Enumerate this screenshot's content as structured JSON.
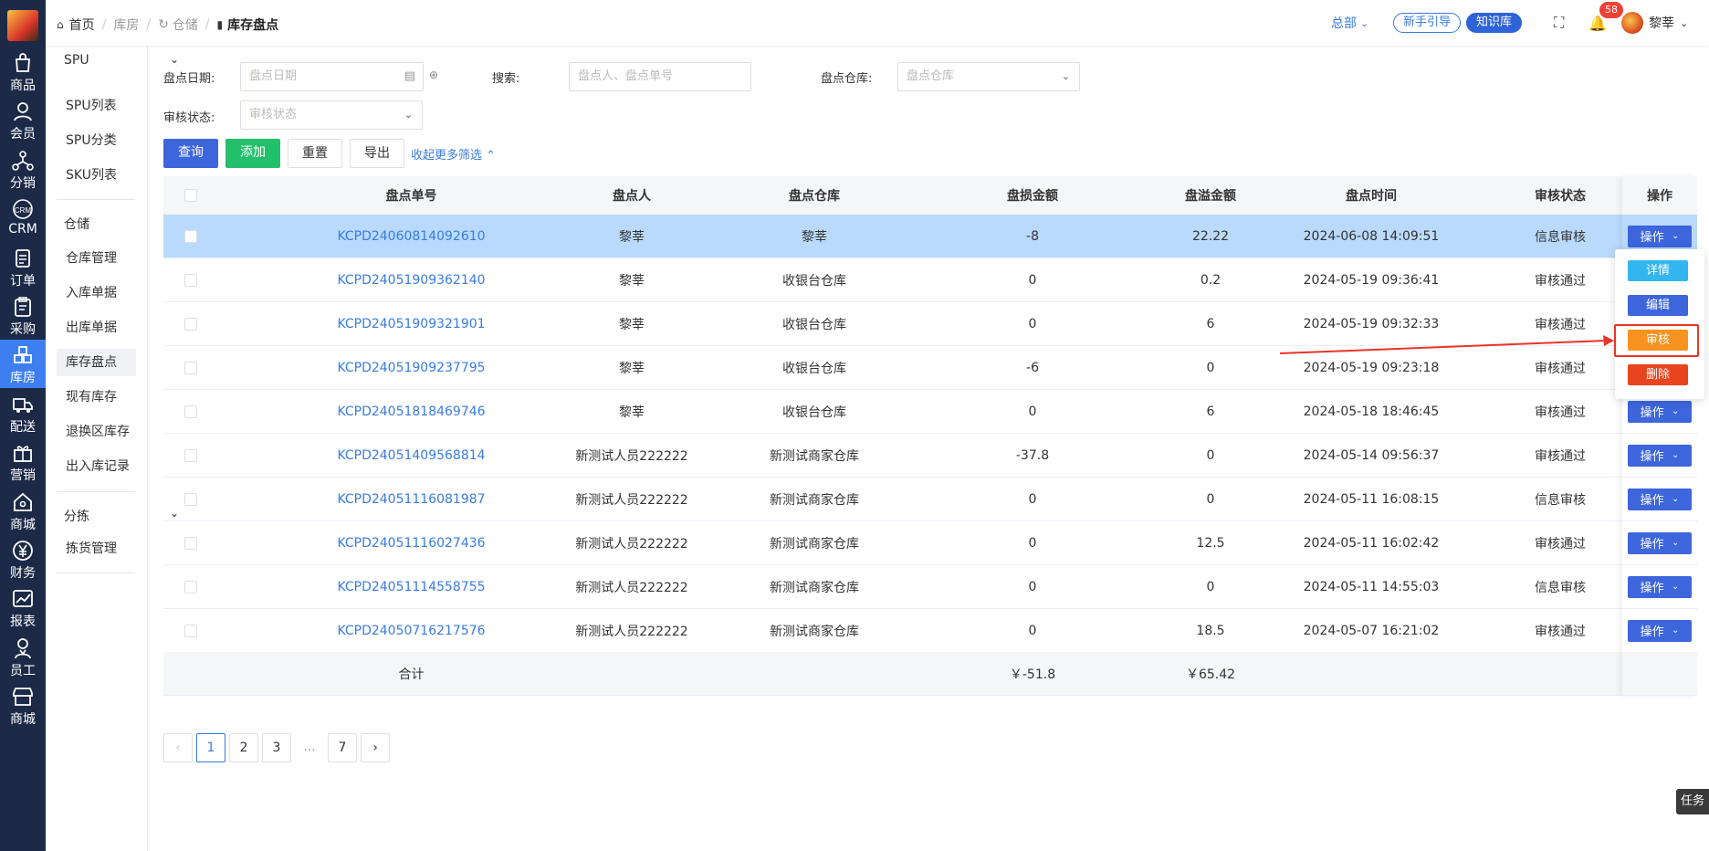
{
  "colors": {
    "primary": "#3d65dc",
    "accent": "#3d7ff0",
    "success": "#23c06b",
    "review": "#f7931e",
    "danger": "#e8451e",
    "info": "#33b6ef",
    "link": "#3a7be0",
    "selected_row": "#b9dafd",
    "sidebar_bg": "#1c2a48"
  },
  "topbar": {
    "breadcrumb": [
      "首页",
      "库房",
      "仓储",
      "库存盘点"
    ],
    "org": "总部",
    "guide": "新手引导",
    "knowledge": "知识库",
    "notifications": "58",
    "user": "黎莘"
  },
  "leftnav": [
    {
      "label": "商品",
      "icon": "bag-icon"
    },
    {
      "label": "会员",
      "icon": "user-icon"
    },
    {
      "label": "分销",
      "icon": "network-icon"
    },
    {
      "label": "CRM",
      "icon": "crm-icon"
    },
    {
      "label": "订单",
      "icon": "order-icon"
    },
    {
      "label": "采购",
      "icon": "clipboard-icon"
    },
    {
      "label": "库房",
      "icon": "warehouse-icon",
      "active": true
    },
    {
      "label": "配送",
      "icon": "truck-icon"
    },
    {
      "label": "营销",
      "icon": "gift-icon"
    },
    {
      "label": "商城",
      "icon": "home-icon"
    },
    {
      "label": "财务",
      "icon": "yen-icon"
    },
    {
      "label": "报表",
      "icon": "chart-icon"
    },
    {
      "label": "员工",
      "icon": "staff-icon"
    },
    {
      "label": "商城",
      "icon": "store-icon"
    }
  ],
  "subnav": {
    "groups": [
      {
        "title": "SPU",
        "items": [
          "SPU列表",
          "SPU分类",
          "SKU列表"
        ]
      },
      {
        "title": "仓储",
        "items": [
          "仓库管理",
          "入库单据",
          "出库单据",
          "库存盘点",
          "现有库存",
          "退换区库存",
          "出入库记录"
        ]
      },
      {
        "title": "分拣",
        "items": [
          "拣货管理"
        ]
      }
    ],
    "collapse": "收起"
  },
  "filters": {
    "date_label": "盘点日期:",
    "date_placeholder": "盘点日期",
    "search_label": "搜索:",
    "search_placeholder": "盘点人、盘点单号",
    "warehouse_label": "盘点仓库:",
    "warehouse_placeholder": "盘点仓库",
    "status_label": "审核状态:",
    "status_placeholder": "审核状态"
  },
  "buttons": {
    "query": "查询",
    "add": "添加",
    "reset": "重置",
    "export": "导出",
    "toggle": "收起更多筛选"
  },
  "table": {
    "columns": [
      "盘点单号",
      "盘点人",
      "盘点仓库",
      "盘损金额",
      "盘溢金额",
      "盘点时间",
      "审核状态",
      "操作"
    ],
    "op_label": "操作",
    "rows": [
      {
        "id": "KCPD24060814092610",
        "person": "黎莘",
        "warehouse": "黎莘",
        "loss": "-8",
        "gain": "22.22",
        "time": "2024-06-08 14:09:51",
        "status": "信息审核",
        "selected": true
      },
      {
        "id": "KCPD24051909362140",
        "person": "黎莘",
        "warehouse": "收银台仓库",
        "loss": "0",
        "gain": "0.2",
        "time": "2024-05-19 09:36:41",
        "status": "审核通过"
      },
      {
        "id": "KCPD24051909321901",
        "person": "黎莘",
        "warehouse": "收银台仓库",
        "loss": "0",
        "gain": "6",
        "time": "2024-05-19 09:32:33",
        "status": "审核通过"
      },
      {
        "id": "KCPD24051909237795",
        "person": "黎莘",
        "warehouse": "收银台仓库",
        "loss": "-6",
        "gain": "0",
        "time": "2024-05-19 09:23:18",
        "status": "审核通过"
      },
      {
        "id": "KCPD24051818469746",
        "person": "黎莘",
        "warehouse": "收银台仓库",
        "loss": "0",
        "gain": "6",
        "time": "2024-05-18 18:46:45",
        "status": "审核通过"
      },
      {
        "id": "KCPD24051409568814",
        "person": "新测试人员222222",
        "warehouse": "新测试商家仓库",
        "loss": "-37.8",
        "gain": "0",
        "time": "2024-05-14 09:56:37",
        "status": "审核通过"
      },
      {
        "id": "KCPD24051116081987",
        "person": "新测试人员222222",
        "warehouse": "新测试商家仓库",
        "loss": "0",
        "gain": "0",
        "time": "2024-05-11 16:08:15",
        "status": "信息审核"
      },
      {
        "id": "KCPD24051116027436",
        "person": "新测试人员222222",
        "warehouse": "新测试商家仓库",
        "loss": "0",
        "gain": "12.5",
        "time": "2024-05-11 16:02:42",
        "status": "审核通过"
      },
      {
        "id": "KCPD24051114558755",
        "person": "新测试人员222222",
        "warehouse": "新测试商家仓库",
        "loss": "0",
        "gain": "0",
        "time": "2024-05-11 14:55:03",
        "status": "信息审核"
      },
      {
        "id": "KCPD24050716217576",
        "person": "新测试人员222222",
        "warehouse": "新测试商家仓库",
        "loss": "0",
        "gain": "18.5",
        "time": "2024-05-07 16:21:02",
        "status": "审核通过"
      }
    ],
    "total": {
      "label": "合计",
      "loss": "￥-51.8",
      "gain": "￥65.42"
    }
  },
  "pagination": {
    "pages": [
      "1",
      "2",
      "3",
      "...",
      "7"
    ],
    "current": "1"
  },
  "dropdown": {
    "detail": "详情",
    "edit": "编辑",
    "review": "审核",
    "delete": "删除"
  },
  "task": "任务"
}
